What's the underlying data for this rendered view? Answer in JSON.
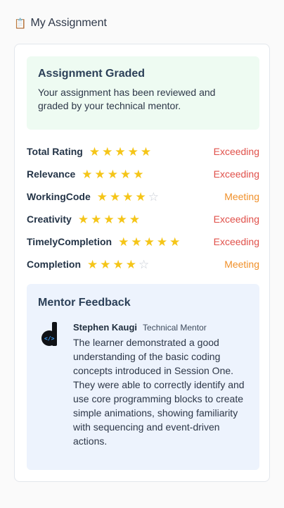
{
  "header": {
    "icon": "clipboard-icon",
    "title": "My Assignment"
  },
  "graded": {
    "title": "Assignment Graded",
    "text": "Your assignment has been reviewed and graded by your technical mentor."
  },
  "ratings": [
    {
      "label": "Total Rating",
      "stars": 5,
      "max_stars": 5,
      "status": "Exceeding"
    },
    {
      "label": "Relevance",
      "stars": 5,
      "max_stars": 5,
      "status": "Exceeding"
    },
    {
      "label": "WorkingCode",
      "stars": 4,
      "max_stars": 5,
      "status": "Meeting"
    },
    {
      "label": "Creativity",
      "stars": 5,
      "max_stars": 5,
      "status": "Exceeding"
    },
    {
      "label": "TimelyCompletion",
      "stars": 5,
      "max_stars": 5,
      "status": "Exceeding"
    },
    {
      "label": "Completion",
      "stars": 4,
      "max_stars": 5,
      "status": "Meeting"
    }
  ],
  "feedback": {
    "title": "Mentor Feedback",
    "mentor_name": "Stephen Kaugi",
    "mentor_role": "Technical Mentor",
    "avatar_icon": "mentor-logo-icon",
    "text": "The learner demonstrated a good understanding of the basic coding concepts introduced in Session One. They were able to correctly identify and use core programming blocks to create simple animations, showing familiarity with sequencing and event-driven actions."
  },
  "colors": {
    "star_full": "#f5c518",
    "star_empty": "#c9ced6",
    "exceeding": "#e0504a",
    "meeting": "#f0902a",
    "graded_bg": "#eefbf2",
    "feedback_bg": "#edf3fd"
  }
}
